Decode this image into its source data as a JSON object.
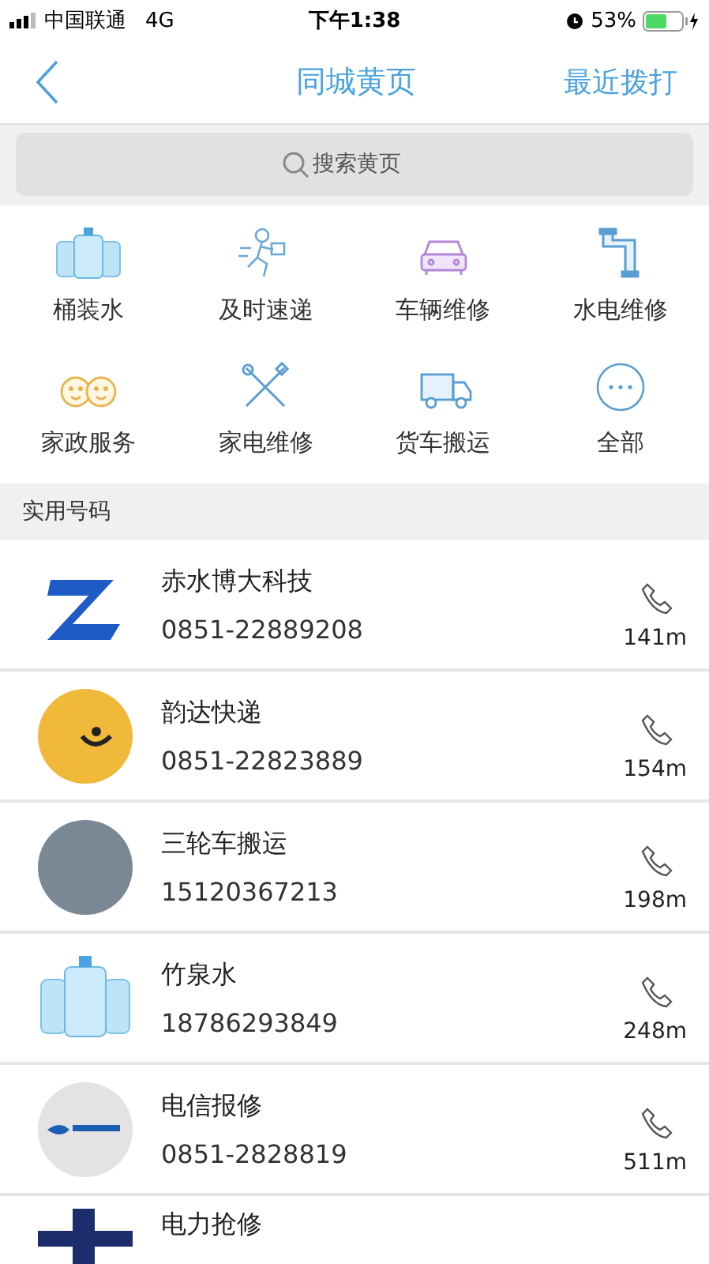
{
  "status_bar": {
    "carrier": "中国联通",
    "network": "4G",
    "time": "下午1:38",
    "battery": "53%"
  },
  "nav": {
    "title": "同城黄页",
    "action": "最近拨打"
  },
  "search": {
    "placeholder": "搜索黄页"
  },
  "categories": [
    {
      "label": "桶装水",
      "kind": "water"
    },
    {
      "label": "及时速递",
      "kind": "courier"
    },
    {
      "label": "车辆维修",
      "kind": "car"
    },
    {
      "label": "水电维修",
      "kind": "pipe"
    },
    {
      "label": "家政服务",
      "kind": "housekeeping"
    },
    {
      "label": "家电维修",
      "kind": "tools"
    },
    {
      "label": "货车搬运",
      "kind": "truck"
    },
    {
      "label": "全部",
      "kind": "more"
    }
  ],
  "section_title": "实用号码",
  "contacts": [
    {
      "name": "赤水博大科技",
      "phone": "0851-22889208",
      "distance": "141m",
      "kind": "letter-logo"
    },
    {
      "name": "韵达快递",
      "phone": "0851-22823889",
      "distance": "154m",
      "kind": "smile-logo"
    },
    {
      "name": "三轮车搬运",
      "phone": "15120367213",
      "distance": "198m",
      "kind": "photo"
    },
    {
      "name": "竹泉水",
      "phone": "18786293849",
      "distance": "248m",
      "kind": "water"
    },
    {
      "name": "电信报修",
      "phone": "0851-2828819",
      "distance": "511m",
      "kind": "grey-logo"
    },
    {
      "name": "电力抢修",
      "kind": "dark-logo"
    }
  ]
}
